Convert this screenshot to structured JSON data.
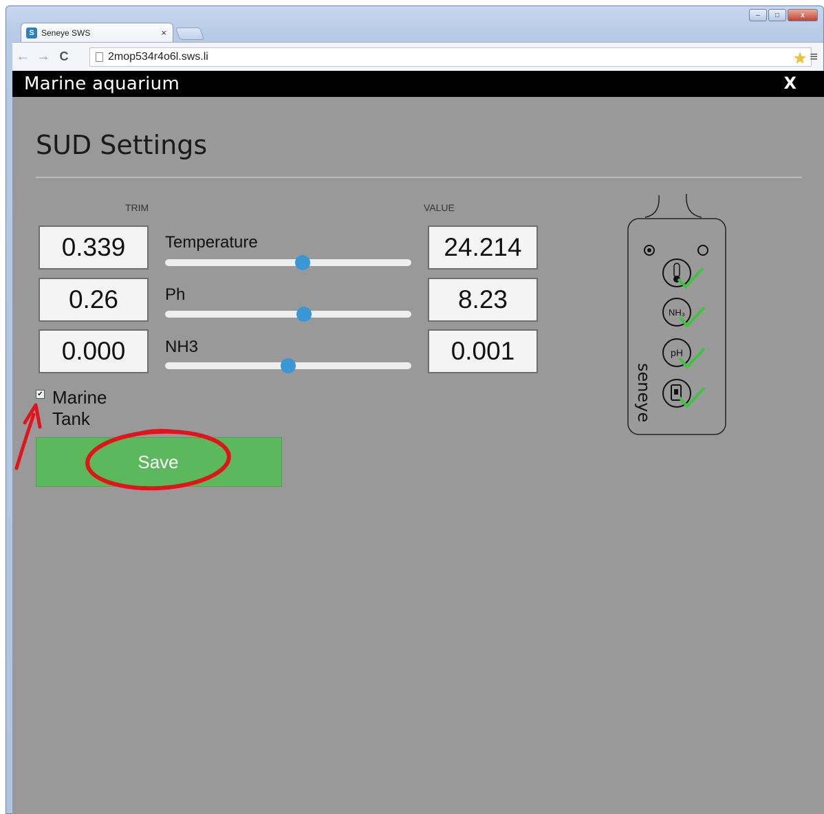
{
  "browser": {
    "tab_title": "Seneye SWS",
    "tab_close": "×",
    "url": "2mop534r4o6l.sws.li",
    "window_controls": {
      "minimize": "–",
      "maximize": "□",
      "close": "x"
    }
  },
  "app": {
    "title": "Marine aquarium",
    "close_label": "X"
  },
  "page": {
    "title": "SUD Settings",
    "col_trim": "TRIM",
    "col_value": "VALUE",
    "rows": [
      {
        "trim": "0.339",
        "label": "Temperature",
        "value": "24.214",
        "slider_fraction": 0.56
      },
      {
        "trim": "0.26",
        "label": "Ph",
        "value": "8.23",
        "slider_fraction": 0.565
      },
      {
        "trim": "0.000",
        "label": "NH3",
        "value": "0.001",
        "slider_fraction": 0.5
      }
    ],
    "marine_tank_label": "Marine Tank",
    "marine_tank_checked": true,
    "save_label": "Save"
  },
  "device": {
    "brand": "seneye",
    "sensor_badges": [
      "NH₃",
      "pH"
    ]
  },
  "colors": {
    "app_bar": "#000000",
    "background": "#999999",
    "save_button": "#5cb85c",
    "slider_thumb": "#3a97d6",
    "annotation": "#e0141a",
    "check": "#3ec43e"
  }
}
